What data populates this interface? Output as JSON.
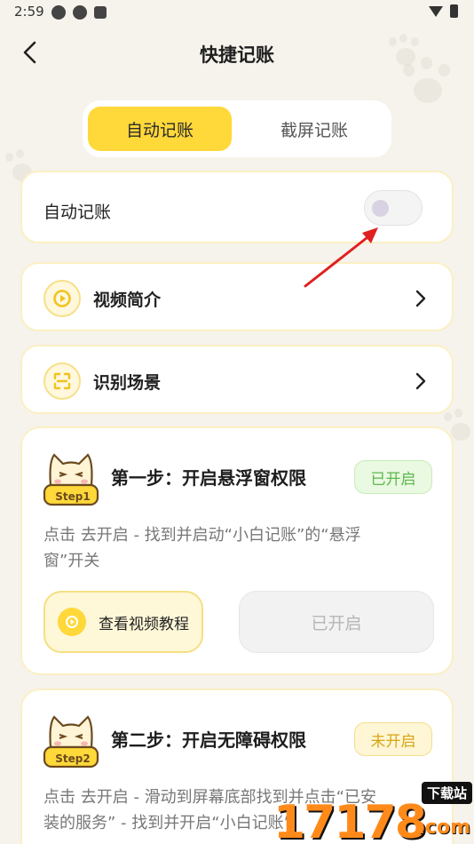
{
  "status_bar": {
    "time": "2:59"
  },
  "nav": {
    "title": "快捷记账"
  },
  "tabs": [
    {
      "label": "自动记账",
      "active": true
    },
    {
      "label": "截屏记账",
      "active": false
    }
  ],
  "auto_toggle": {
    "label": "自动记账",
    "on": false
  },
  "menu": [
    {
      "label": "视频简介"
    },
    {
      "label": "识别场景"
    }
  ],
  "steps": [
    {
      "badge": "Step1",
      "title": "第一步：开启悬浮窗权限",
      "status": "已开启",
      "desc_line1": "点击 去开启 - 找到并启动“小白记账”的“悬浮",
      "desc_line2": "窗”开关",
      "video_button": "查看视频教程",
      "action_button": "已开启"
    },
    {
      "badge": "Step2",
      "title": "第二步：开启无障碍权限",
      "status": "未开启",
      "desc_line1": "点击 去开启 - 滑动到屏幕底部找到并点击“已安",
      "desc_line2": "装的服务” - 找到并开启“小白记账”"
    }
  ],
  "watermark": {
    "tag": "下载站",
    "number": "17178",
    "suffix": ".com"
  },
  "colors": {
    "accent": "#ffd83a",
    "on": "#5bb84c",
    "off": "#d6a614",
    "background": "#f6f3ec"
  }
}
